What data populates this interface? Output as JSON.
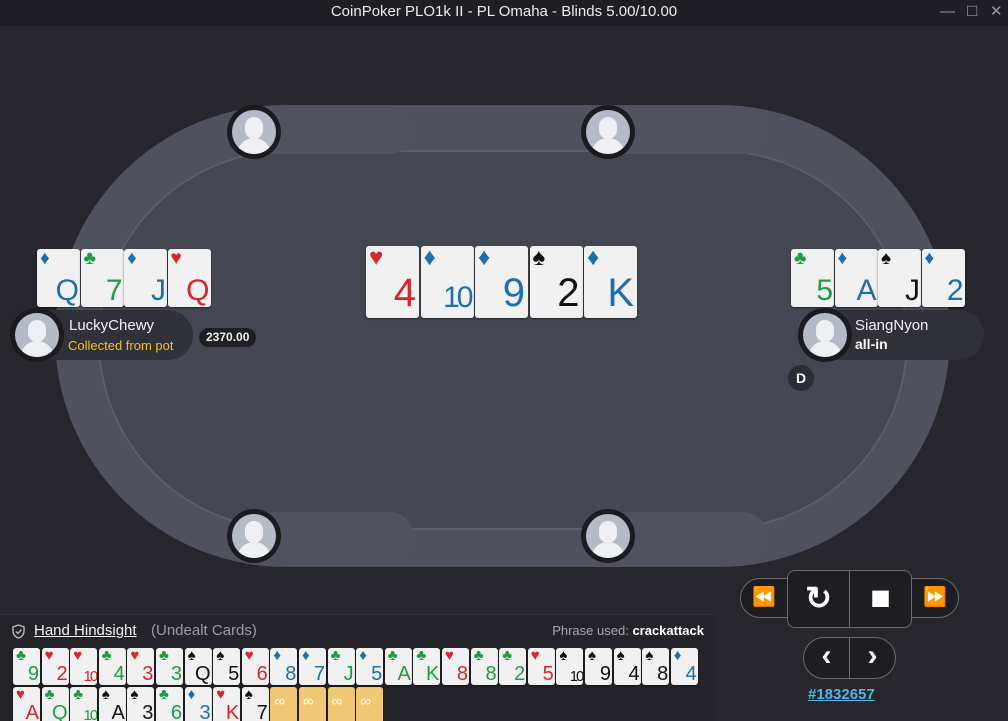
{
  "window": {
    "title": "CoinPoker PLO1k II - PL Omaha - Blinds 5.00/10.00",
    "minimize": "—",
    "maximize": "□",
    "close": "✕"
  },
  "players": {
    "left": {
      "name": "LuckyChewy",
      "status": "Collected from pot",
      "stack": "2370.00",
      "status_color": "#f2c318",
      "cards": [
        {
          "rank": "Q",
          "suit": "d"
        },
        {
          "rank": "7",
          "suit": "c"
        },
        {
          "rank": "J",
          "suit": "d"
        },
        {
          "rank": "Q",
          "suit": "h"
        }
      ]
    },
    "right": {
      "name": "SiangNyon",
      "status": "all-in",
      "cards": [
        {
          "rank": "5",
          "suit": "c"
        },
        {
          "rank": "A",
          "suit": "d"
        },
        {
          "rank": "J",
          "suit": "s"
        },
        {
          "rank": "2",
          "suit": "d"
        }
      ]
    }
  },
  "dealer_button": "D",
  "board": [
    {
      "rank": "4",
      "suit": "h"
    },
    {
      "rank": "10",
      "suit": "d"
    },
    {
      "rank": "9",
      "suit": "d"
    },
    {
      "rank": "2",
      "suit": "s"
    },
    {
      "rank": "K",
      "suit": "d"
    }
  ],
  "suit_glyphs": {
    "h": "♥",
    "d": "♦",
    "c": "♣",
    "s": "♠"
  },
  "suit_colors": {
    "h": "#d6262f",
    "d": "#1b6fb0",
    "c": "#1e9c45",
    "s": "#111111"
  },
  "replay_controls": {
    "rewind": "⏪",
    "replay": "↻",
    "stop": "■",
    "fast_forward": "⏩",
    "prev": "‹",
    "next": "›"
  },
  "hand_id": "#1832657",
  "hindsight": {
    "title": "Hand Hindsight",
    "subtitle": "(Undealt Cards)",
    "phrase_label": "Phrase used:",
    "phrase": "crackattack",
    "row1": [
      {
        "rank": "9",
        "suit": "c"
      },
      {
        "rank": "2",
        "suit": "h"
      },
      {
        "rank": "10",
        "suit": "h"
      },
      {
        "rank": "4",
        "suit": "c"
      },
      {
        "rank": "3",
        "suit": "h"
      },
      {
        "rank": "3",
        "suit": "c"
      },
      {
        "rank": "Q",
        "suit": "s"
      },
      {
        "rank": "5",
        "suit": "s"
      },
      {
        "rank": "6",
        "suit": "h"
      },
      {
        "rank": "8",
        "suit": "d"
      },
      {
        "rank": "7",
        "suit": "d"
      },
      {
        "rank": "J",
        "suit": "c"
      },
      {
        "rank": "5",
        "suit": "d"
      },
      {
        "rank": "A",
        "suit": "c"
      },
      {
        "rank": "K",
        "suit": "c"
      },
      {
        "rank": "8",
        "suit": "h"
      },
      {
        "rank": "8",
        "suit": "c"
      },
      {
        "rank": "2",
        "suit": "c"
      },
      {
        "rank": "5",
        "suit": "h"
      },
      {
        "rank": "10",
        "suit": "s"
      },
      {
        "rank": "9",
        "suit": "s"
      },
      {
        "rank": "4",
        "suit": "s"
      },
      {
        "rank": "8",
        "suit": "s"
      },
      {
        "rank": "4",
        "suit": "d"
      }
    ],
    "row2": [
      {
        "rank": "A",
        "suit": "h"
      },
      {
        "rank": "Q",
        "suit": "c"
      },
      {
        "rank": "10",
        "suit": "c"
      },
      {
        "rank": "A",
        "suit": "s"
      },
      {
        "rank": "3",
        "suit": "s"
      },
      {
        "rank": "6",
        "suit": "c"
      },
      {
        "rank": "3",
        "suit": "d"
      },
      {
        "rank": "K",
        "suit": "h"
      },
      {
        "rank": "7",
        "suit": "s"
      }
    ],
    "blank_count": 4,
    "blank_glyph": "∞"
  }
}
